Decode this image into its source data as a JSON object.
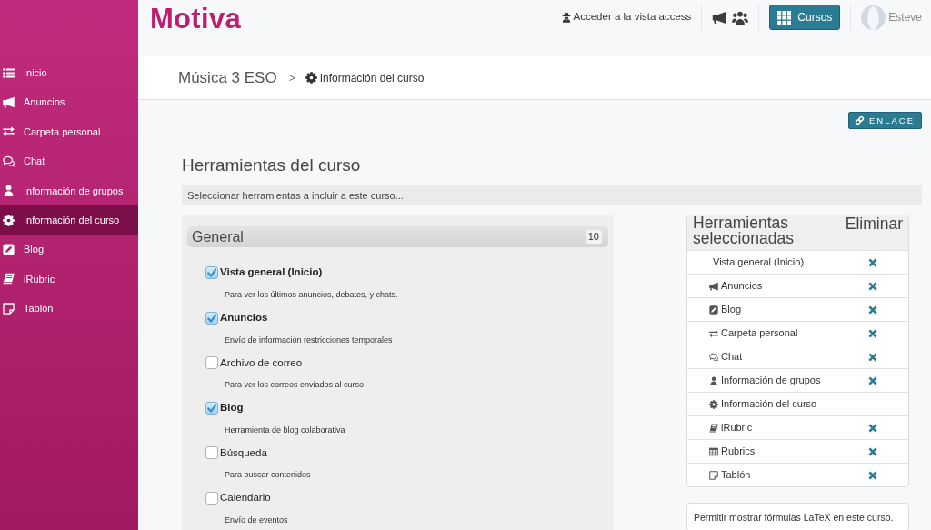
{
  "header": {
    "logo": "Motiva",
    "access_link": "Acceder a la vista access",
    "courses_button": "Cursos",
    "user_name": "Esteve"
  },
  "sidebar": {
    "items": [
      {
        "label": "Inicio",
        "selected": false
      },
      {
        "label": "Anuncios",
        "selected": false
      },
      {
        "label": "Carpeta personal",
        "selected": false
      },
      {
        "label": "Chat",
        "selected": false
      },
      {
        "label": "Información de grupos",
        "selected": false
      },
      {
        "label": "Información del curso",
        "selected": true
      },
      {
        "label": "Blog",
        "selected": false
      },
      {
        "label": "iRubric",
        "selected": false
      },
      {
        "label": "Tablón",
        "selected": false
      }
    ]
  },
  "breadcrumb": {
    "items": [
      "Música 3 ESO",
      "Información del curso"
    ],
    "separator": ">"
  },
  "link_button": "ENLACE",
  "section_title": "Herramientas del curso",
  "instructions": "Seleccionar herramientas a incluir a este curso...",
  "tool_group": {
    "title": "General",
    "count": "10",
    "tools": [
      {
        "name": "Vista general (Inicio)",
        "description": "Para ver los últimos anuncios, debates, y chats.",
        "checked": true
      },
      {
        "name": "Anuncios",
        "description": "Envío de información restricciones temporales",
        "checked": true
      },
      {
        "name": "Archivo de correo",
        "description": "Para ver los correos enviados al curso",
        "checked": false
      },
      {
        "name": "Blog",
        "description": "Herramienta de blog colaborativa",
        "checked": true
      },
      {
        "name": "Búsqueda",
        "description": "Para buscar contenidos",
        "checked": false
      },
      {
        "name": "Calendario",
        "description": "Envío de eventos",
        "checked": false
      }
    ]
  },
  "selected_tools": {
    "columns": [
      "Herramientas seleccionadas",
      "Eliminar"
    ],
    "rows": [
      {
        "label": "Vista general (Inicio)",
        "removable": true
      },
      {
        "label": "Anuncios",
        "removable": true
      },
      {
        "label": "Blog",
        "removable": true
      },
      {
        "label": "Carpeta personal",
        "removable": true
      },
      {
        "label": "Chat",
        "removable": true
      },
      {
        "label": "Información de grupos",
        "removable": true
      },
      {
        "label": "Información del curso",
        "removable": false
      },
      {
        "label": "iRubric",
        "removable": true
      },
      {
        "label": "Rubrics",
        "removable": true
      },
      {
        "label": "Tablón",
        "removable": true
      }
    ]
  },
  "latex_note": "Permitir mostrar fórmulas LaTeX en este curso."
}
